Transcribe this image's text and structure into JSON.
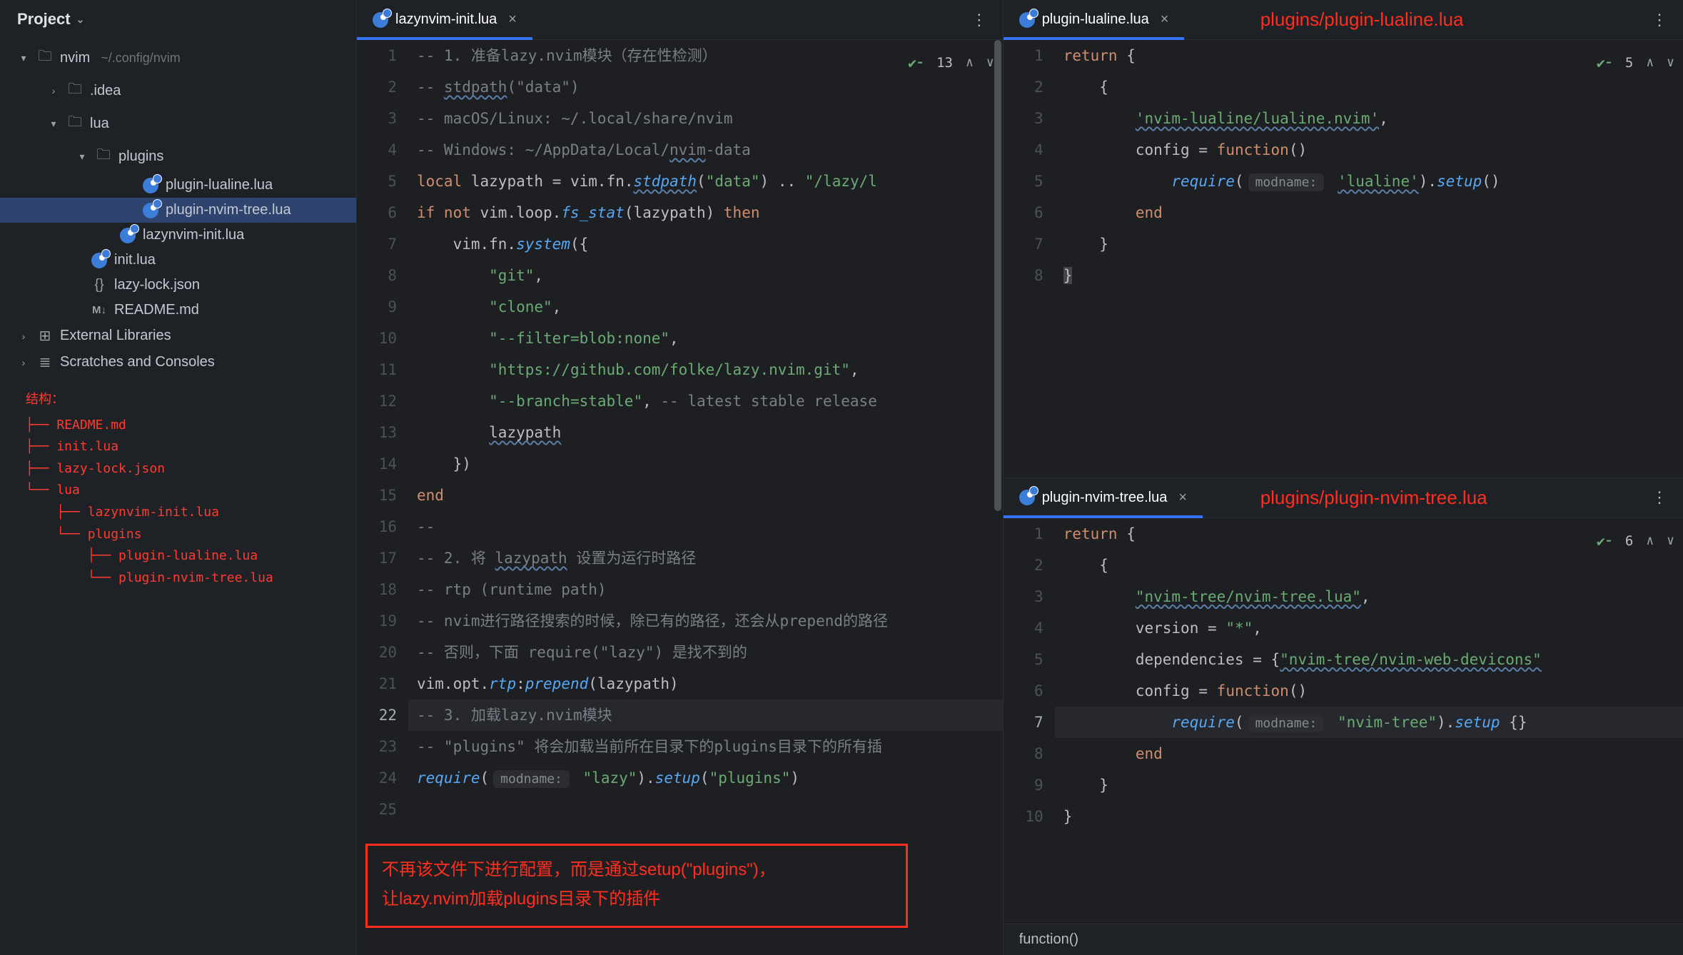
{
  "sidebar": {
    "header": "Project",
    "tree": [
      {
        "indent": 24,
        "arrow": "▾",
        "icon": "folder",
        "label": "nvim",
        "suffix": "~/.config/nvim"
      },
      {
        "indent": 66,
        "arrow": "›",
        "icon": "folder",
        "label": ".idea"
      },
      {
        "indent": 66,
        "arrow": "▾",
        "icon": "folder",
        "label": "lua"
      },
      {
        "indent": 106,
        "arrow": "▾",
        "icon": "folder",
        "label": "plugins"
      },
      {
        "indent": 172,
        "arrow": "",
        "icon": "lua",
        "label": "plugin-lualine.lua"
      },
      {
        "indent": 172,
        "arrow": "",
        "icon": "lua",
        "label": "plugin-nvim-tree.lua",
        "selected": true
      },
      {
        "indent": 140,
        "arrow": "",
        "icon": "lua",
        "label": "lazynvim-init.lua"
      },
      {
        "indent": 100,
        "arrow": "",
        "icon": "lua",
        "label": "init.lua"
      },
      {
        "indent": 100,
        "arrow": "",
        "icon": "json",
        "label": "lazy-lock.json"
      },
      {
        "indent": 100,
        "arrow": "",
        "icon": "md",
        "label": "README.md"
      },
      {
        "indent": 24,
        "arrow": "›",
        "icon": "lib",
        "label": "External Libraries"
      },
      {
        "indent": 24,
        "arrow": "›",
        "icon": "scratch",
        "label": "Scratches and Consoles"
      }
    ],
    "structHeader": "结构：",
    "struct": [
      "├── README.md",
      "├── init.lua",
      "├── lazy-lock.json",
      "└── lua",
      "    ├── lazynvim-init.lua",
      "    └── plugins",
      "        ├── plugin-lualine.lua",
      "        └── plugin-nvim-tree.lua"
    ]
  },
  "editors": {
    "left": {
      "tab": "lazynvim-init.lua",
      "badge": {
        "count": "13"
      },
      "highlightLine": 22,
      "lines": [
        {
          "t": "com",
          "s": "-- 1. 准备lazy.nvim模块（存在性检测）"
        },
        {
          "t": "raw",
          "h": "<span class='c-com'>-- </span><span class='c-com c-wavy'>stdpath</span><span class='c-com'>(\"data\")</span>"
        },
        {
          "t": "com",
          "s": "-- macOS/Linux: ~/.local/share/nvim"
        },
        {
          "t": "raw",
          "h": "<span class='c-com'>-- Windows: ~/AppData/Local/</span><span class='c-com c-wavy'>nvim</span><span class='c-com'>-data</span>"
        },
        {
          "t": "raw",
          "h": "<span class='c-kw'>local</span> <span class='c-id'>lazypath</span> <span class='c-punc'>=</span> <span class='c-id'>vim.fn.</span><span class='c-fn-it c-wavy'>stdpath</span><span class='c-punc'>(</span><span class='c-str'>\"data\"</span><span class='c-punc'>) .. </span><span class='c-str'>\"/lazy/l</span>"
        },
        {
          "t": "raw",
          "h": "<span class='c-kw'>if not</span> <span class='c-id'>vim.loop.</span><span class='c-fn-it'>fs_stat</span><span class='c-punc'>(lazypath) </span><span class='c-kw'>then</span>"
        },
        {
          "t": "raw",
          "h": "    <span class='c-id'>vim.fn.</span><span class='c-fn-it'>system</span><span class='c-punc'>({</span>"
        },
        {
          "t": "raw",
          "h": "        <span class='c-str'>\"git\"</span><span class='c-punc'>,</span>"
        },
        {
          "t": "raw",
          "h": "        <span class='c-str'>\"clone\"</span><span class='c-punc'>,</span>"
        },
        {
          "t": "raw",
          "h": "        <span class='c-str'>\"--filter=blob:none\"</span><span class='c-punc'>,</span>"
        },
        {
          "t": "raw",
          "h": "        <span class='c-str'>\"https://github.com/folke/lazy.nvim.git\"</span><span class='c-punc'>,</span>"
        },
        {
          "t": "raw",
          "h": "        <span class='c-str'>\"--branch=stable\"</span><span class='c-punc'>,</span> <span class='c-com'>-- latest stable release</span>"
        },
        {
          "t": "raw",
          "h": "        <span class='c-id c-wavy'>lazypath</span>"
        },
        {
          "t": "raw",
          "h": "    <span class='c-punc'>})</span>"
        },
        {
          "t": "raw",
          "h": "<span class='c-kw'>end</span>"
        },
        {
          "t": "com",
          "s": "--"
        },
        {
          "t": "raw",
          "h": "<span class='c-com'>-- 2. 将 </span><span class='c-com c-wavy'>lazypath</span><span class='c-com'> 设置为运行时路径</span>"
        },
        {
          "t": "com",
          "s": "-- rtp (runtime path)"
        },
        {
          "t": "com",
          "s": "-- nvim进行路径搜索的时候，除已有的路径，还会从prepend的路径"
        },
        {
          "t": "com",
          "s": "-- 否则，下面 require(\"lazy\") 是找不到的"
        },
        {
          "t": "raw",
          "h": "<span class='c-id'>vim.opt.</span><span class='c-fn-it'>rtp</span><span class='c-punc'>:</span><span class='c-fn'>prepend</span><span class='c-punc'>(lazypath)</span>"
        },
        {
          "t": "com",
          "s": "-- 3. 加载lazy.nvim模块"
        },
        {
          "t": "com",
          "s": "-- \"plugins\" 将会加载当前所在目录下的plugins目录下的所有插"
        },
        {
          "t": "raw",
          "h": "<span class='c-fn'>require</span><span class='c-punc'>(</span><span class='c-hint'>modname:</span> <span class='c-str'>\"lazy\"</span><span class='c-punc'>).</span><span class='c-fn-it'>setup</span><span class='c-punc'>(</span><span class='c-str'>\"plugins\"</span><span class='c-punc'>)</span>"
        },
        {
          "t": "raw",
          "h": ""
        }
      ],
      "annotation": "不再该文件下进行配置，而是通过setup(\"plugins\")，\n让lazy.nvim加载plugins目录下的插件"
    },
    "rightTop": {
      "tab": "plugin-lualine.lua",
      "overlay": "plugins/plugin-lualine.lua",
      "badge": {
        "count": "5"
      },
      "lines": [
        {
          "t": "raw",
          "h": "<span class='c-kw'>return</span> <span class='c-punc'>{</span>"
        },
        {
          "t": "raw",
          "h": "    <span class='c-punc'>{</span>"
        },
        {
          "t": "raw",
          "h": "        <span class='c-str c-wavy'>'nvim-lualine/lualine.nvim'</span><span class='c-punc'>,</span>"
        },
        {
          "t": "raw",
          "h": "        <span class='c-id'>config</span> <span class='c-punc'>=</span> <span class='c-kw'>function</span><span class='c-punc'>()</span>"
        },
        {
          "t": "raw",
          "h": "            <span class='c-fn'>require</span><span class='c-punc'>(</span><span class='c-hint'>modname:</span> <span class='c-str c-wavy'>'lualine'</span><span class='c-punc'>).</span><span class='c-fn-it'>setup</span><span class='c-punc'>()</span>"
        },
        {
          "t": "raw",
          "h": "        <span class='c-kw'>end</span>"
        },
        {
          "t": "raw",
          "h": "    <span class='c-punc'>}</span>"
        },
        {
          "t": "raw",
          "h": "<span class='c-punc' style='background:#43454a'>}</span>"
        }
      ]
    },
    "rightBottom": {
      "tab": "plugin-nvim-tree.lua",
      "overlay": "plugins/plugin-nvim-tree.lua",
      "badge": {
        "count": "6"
      },
      "highlightLine": 7,
      "lines": [
        {
          "t": "raw",
          "h": "<span class='c-kw'>return</span> <span class='c-punc'>{</span>"
        },
        {
          "t": "raw",
          "h": "    <span class='c-punc'>{</span>"
        },
        {
          "t": "raw",
          "h": "        <span class='c-str c-wavy'>\"nvim-tree/nvim-tree.lua\"</span><span class='c-punc'>,</span>"
        },
        {
          "t": "raw",
          "h": "        <span class='c-id'>version</span> <span class='c-punc'>=</span> <span class='c-str'>\"*\"</span><span class='c-punc'>,</span>"
        },
        {
          "t": "raw",
          "h": "        <span class='c-id'>dependencies</span> <span class='c-punc'>= {</span><span class='c-str c-wavy'>\"nvim-tree/nvim-web-devicons\"</span>"
        },
        {
          "t": "raw",
          "h": "        <span class='c-id'>config</span> <span class='c-punc'>=</span> <span class='c-kw'>function</span><span class='c-punc'>()</span>"
        },
        {
          "t": "raw",
          "h": "            <span class='c-fn'>require</span><span class='c-punc'>(</span><span class='c-hint'>modname:</span> <span class='c-str'>\"nvim-tree\"</span><span class='c-punc'>).</span><span class='c-fn-it'>setup</span> <span class='c-punc'>{}</span>"
        },
        {
          "t": "raw",
          "h": "        <span class='c-kw'>end</span>"
        },
        {
          "t": "raw",
          "h": "    <span class='c-punc'>}</span>"
        },
        {
          "t": "raw",
          "h": "<span class='c-punc'>}</span>"
        }
      ],
      "status": "function()"
    }
  }
}
